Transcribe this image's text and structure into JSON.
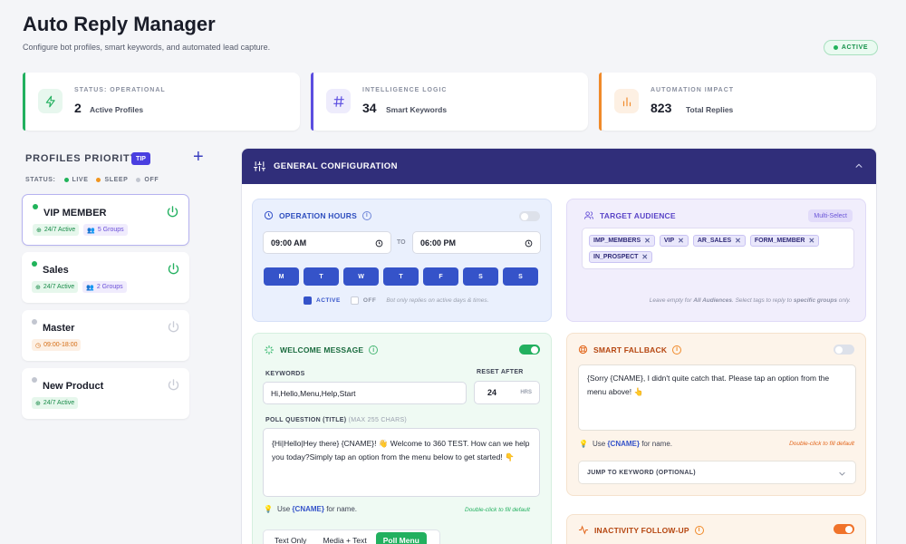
{
  "header": {
    "title": "Auto Reply Manager",
    "subtitle": "Configure bot profiles, smart keywords, and automated lead capture.",
    "status_badge": "ACTIVE"
  },
  "stats": [
    {
      "label": "STATUS: OPERATIONAL",
      "value": "2",
      "desc": "Active Profiles",
      "icon": "bolt-icon",
      "color": "#22b05f"
    },
    {
      "label": "INTELLIGENCE LOGIC",
      "value": "34",
      "desc": "Smart Keywords",
      "icon": "hash-icon",
      "color": "#5b4de0"
    },
    {
      "label": "AUTOMATION IMPACT",
      "value": "823",
      "desc": "Total Replies",
      "icon": "bar-chart-icon",
      "color": "#f08a2a"
    }
  ],
  "profiles": {
    "title": "PROFILES PRIORITY",
    "tip": "TIP",
    "add": "+",
    "status_label": "STATUS:",
    "legend": [
      {
        "label": "LIVE",
        "color": "#20b35a"
      },
      {
        "label": "SLEEP",
        "color": "#f0951f"
      },
      {
        "label": "OFF",
        "color": "#c2c6d0"
      }
    ],
    "items": [
      {
        "name": "VIP MEMBER",
        "tags": [
          "24/7 Active",
          "5 Groups"
        ],
        "status_color": "#20b35a"
      },
      {
        "name": "Sales",
        "tags": [
          "24/7 Active",
          "2 Groups"
        ],
        "status_color": "#20b35a"
      },
      {
        "name": "Master",
        "tags": [
          "09:00-18:00"
        ],
        "status_color": "#c2c6d0"
      },
      {
        "name": "New Product",
        "tags": [
          "24/7 Active"
        ],
        "status_color": "#c2c6d0"
      }
    ]
  },
  "config": {
    "title": "GENERAL CONFIGURATION",
    "operation_hours": {
      "title": "OPERATION HOURS",
      "from": "09:00 AM",
      "to_label": "TO",
      "to": "06:00 PM",
      "days": [
        "M",
        "T",
        "W",
        "T",
        "F",
        "S",
        "S"
      ],
      "active_label": "ACTIVE",
      "off_label": "OFF",
      "note": "Bot only replies on active days & times."
    },
    "target_audience": {
      "title": "TARGET AUDIENCE",
      "badge": "Multi-Select",
      "tags": [
        "IMP_MEMBERS",
        "VIP",
        "AR_SALES",
        "FORM_MEMBER",
        "IN_PROSPECT"
      ],
      "note_a": "Leave empty for ",
      "note_b": "All Audiences",
      "note_c": ". Select tags to reply to ",
      "note_d": "specific groups",
      "note_e": " only."
    },
    "welcome": {
      "title": "WELCOME MESSAGE",
      "keywords_label": "KEYWORDS",
      "keywords": "Hi,Hello,Menu,Help,Start",
      "reset_label": "RESET AFTER",
      "reset_value": "24",
      "reset_unit": "HRS",
      "poll_label": "POLL QUESTION (TITLE)",
      "poll_hint": "(MAX 255 CHARS)",
      "poll_text": "{Hi|Hello|Hey there} {CNAME}! 👋 Welcome to 360 TEST. How can we help you today?Simply tap an option from the menu below to get started! 👇",
      "use_a": "Use ",
      "use_b": "{CNAME}",
      "use_c": " for name.",
      "dbl": "Double-click to fill default",
      "tabs": [
        "Text Only",
        "Media + Text",
        "Poll Menu"
      ]
    },
    "fallback": {
      "title": "SMART FALLBACK",
      "text": "{Sorry {CNAME}, I didn't quite catch that. Please tap an option from the menu above! 👆",
      "use_a": "Use ",
      "use_b": "{CNAME}",
      "use_c": " for name.",
      "dbl": "Double-click to fill default",
      "jump": "JUMP TO KEYWORD (OPTIONAL)"
    },
    "inactivity": {
      "title": "INACTIVITY FOLLOW-UP"
    }
  }
}
